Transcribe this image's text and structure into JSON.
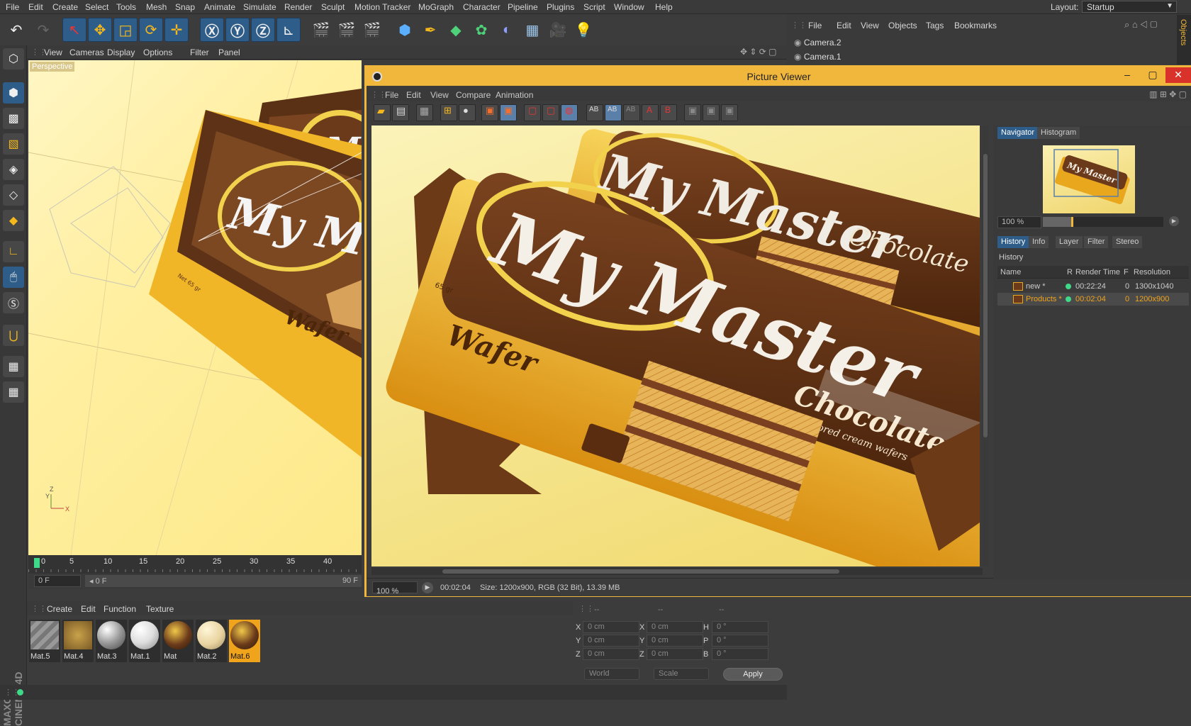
{
  "menubar": {
    "items": [
      "File",
      "Edit",
      "Create",
      "Select",
      "Tools",
      "Mesh",
      "Snap",
      "Animate",
      "Simulate",
      "Render",
      "Sculpt",
      "Motion Tracker",
      "MoGraph",
      "Character",
      "Pipeline",
      "Plugins",
      "Script",
      "Window",
      "Help"
    ],
    "layout_label": "Layout:",
    "layout_value": "Startup"
  },
  "viewport": {
    "menu": [
      "View",
      "Cameras",
      "Display",
      "Options",
      "Filter",
      "Panel"
    ],
    "camera_label": "Perspective"
  },
  "timeline": {
    "ticks": [
      "0",
      "5",
      "10",
      "15",
      "20",
      "25",
      "30",
      "35",
      "40"
    ],
    "current_frame": "0 F",
    "start_frame": "0 F",
    "end_frame": "90 F"
  },
  "materials": {
    "menu": [
      "Create",
      "Edit",
      "Function",
      "Texture"
    ],
    "items": [
      {
        "label": "Mat.5"
      },
      {
        "label": "Mat.4"
      },
      {
        "label": "Mat.3"
      },
      {
        "label": "Mat.1"
      },
      {
        "label": "Mat"
      },
      {
        "label": "Mat.2"
      },
      {
        "label": "Mat.6"
      }
    ]
  },
  "coords": {
    "header": [
      "--",
      "--",
      "--"
    ],
    "rows": [
      {
        "a": "X",
        "av": "0 cm",
        "b": "X",
        "bv": "0 cm",
        "c": "H",
        "cv": "0 °"
      },
      {
        "a": "Y",
        "av": "0 cm",
        "b": "Y",
        "bv": "0 cm",
        "c": "P",
        "cv": "0 °"
      },
      {
        "a": "Z",
        "av": "0 cm",
        "b": "Z",
        "bv": "0 cm",
        "c": "B",
        "cv": "0 °"
      }
    ],
    "world": "World",
    "scale": "Scale",
    "apply": "Apply"
  },
  "object_manager": {
    "menu": [
      "File",
      "Edit",
      "View",
      "Objects",
      "Tags",
      "Bookmarks"
    ],
    "objects": [
      "Camera.2",
      "Camera.1"
    ],
    "side_tab": "Objects"
  },
  "picture_viewer": {
    "title": "Picture Viewer",
    "menu": [
      "File",
      "Edit",
      "View",
      "Compare",
      "Animation"
    ],
    "image": {
      "brand": "My Master",
      "flavor": "Chocolate",
      "flavor_sub": "flavored cream wafers",
      "product": "Wafer",
      "weight": "65 gr"
    },
    "status": {
      "zoom": "100 %",
      "time": "00:02:04",
      "info": "Size: 1200x900, RGB (32 Bit), 13.39 MB"
    },
    "nav_tabs": [
      "Navigator",
      "Histogram"
    ],
    "nav_zoom": "100 %",
    "info_tabs": [
      "History",
      "Info",
      "Layer",
      "Filter",
      "Stereo"
    ],
    "history_title": "History",
    "history_columns": [
      "Name",
      "R",
      "Render Time",
      "F",
      "Resolution"
    ],
    "history_rows": [
      {
        "name": "new *",
        "time": "00:22:24",
        "frame": "0",
        "res": "1300x1040"
      },
      {
        "name": "Products *",
        "time": "00:02:04",
        "frame": "0",
        "res": "1200x900"
      }
    ]
  },
  "colors": {
    "accent": "#f0b73c",
    "selected_text": "#f0a41c",
    "tab_active": "#2f5d8a",
    "render_dot": "#3fd98a"
  }
}
